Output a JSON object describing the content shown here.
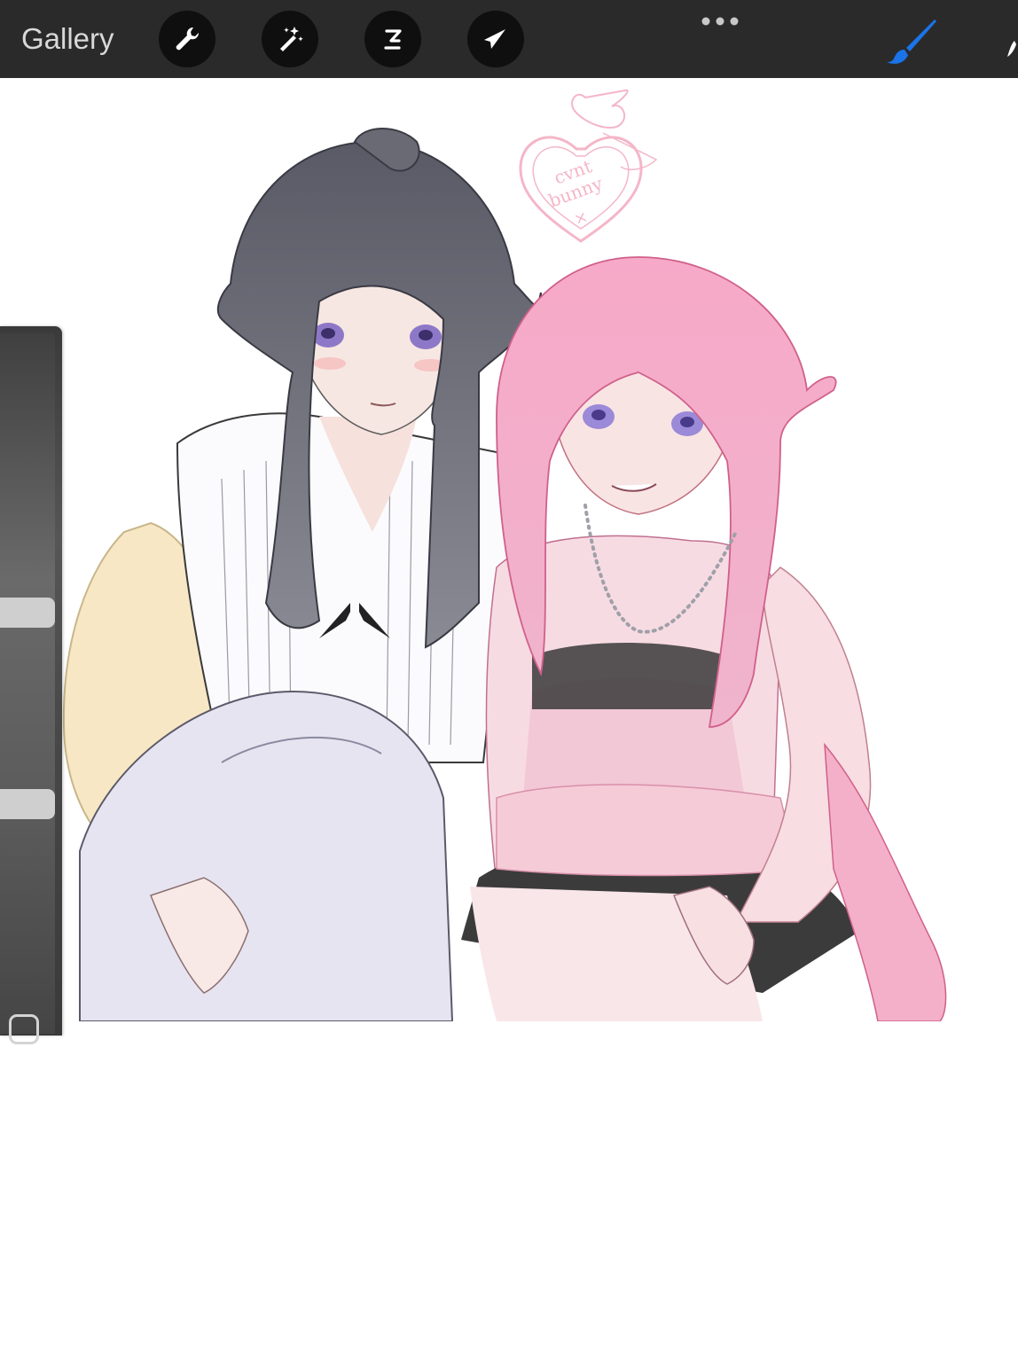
{
  "toolbar": {
    "gallery_label": "Gallery",
    "background": "#2a2a2a",
    "tools": [
      {
        "name": "actions",
        "icon": "wrench-icon"
      },
      {
        "name": "adjustments",
        "icon": "magic-wand-icon"
      },
      {
        "name": "selection",
        "icon": "selection-s-icon"
      },
      {
        "name": "transform",
        "icon": "arrow-cursor-icon"
      }
    ],
    "more_icon": "more-dots-icon",
    "brush_icon": "brush-icon",
    "brush_color": "#1a73e8",
    "smudge_icon": "smudge-icon"
  },
  "sidebar": {
    "size_slider_icon": "slider-handle",
    "modify_icon": "square-icon",
    "opacity_slider_icon": "slider-handle"
  },
  "canvas": {
    "background": "#ffffff",
    "stamp_lines": [
      "cvnt",
      "bunny",
      "×"
    ],
    "stamp_color": "#f4b6c8"
  }
}
